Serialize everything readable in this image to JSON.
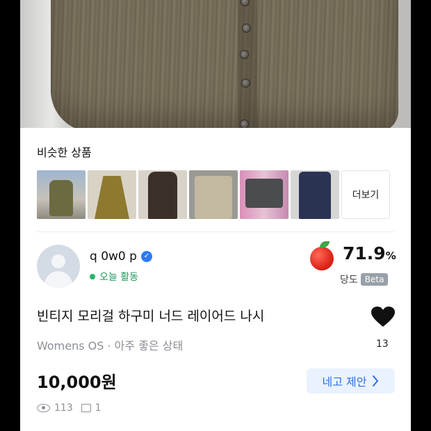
{
  "similar": {
    "title": "비슷한 상품",
    "more_label": "더보기",
    "thumbnails": [
      {
        "icon": "olive-vest-photo"
      },
      {
        "icon": "khaki-slip-dress-photo"
      },
      {
        "icon": "brown-dress-photo"
      },
      {
        "icon": "beige-vest-photo"
      },
      {
        "icon": "grey-vest-photo"
      },
      {
        "icon": "navy-dress-photo"
      }
    ]
  },
  "seller": {
    "name": "q 0w0 p",
    "status": "오늘 활동",
    "sweetness_value": "71.9",
    "sweetness_unit": "%",
    "sweetness_label": "당도",
    "beta_label": "Beta"
  },
  "product": {
    "title": "빈티지 모리걸 하구미 너드 레이어드 나시",
    "meta": "Womens OS · 아주 좋은 상태",
    "like_count": "13",
    "price": "10,000원",
    "offer_label": "네고 제안",
    "views": "113",
    "chats": "1"
  },
  "colors": {
    "accent": "#2f6fe4",
    "online": "#26b36a",
    "badge": "#9aa0a8"
  }
}
